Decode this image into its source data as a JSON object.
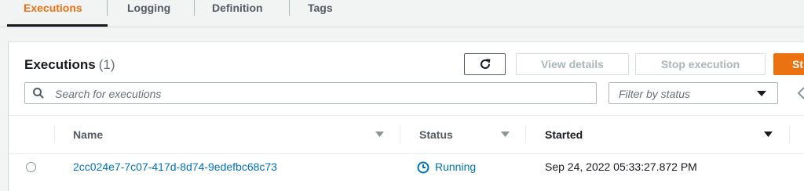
{
  "tabs": [
    {
      "label": "Executions",
      "active": true
    },
    {
      "label": "Logging",
      "active": false
    },
    {
      "label": "Definition",
      "active": false
    },
    {
      "label": "Tags",
      "active": false
    }
  ],
  "panel": {
    "title": "Executions",
    "count": "(1)",
    "buttons": {
      "refresh_icon": "refresh-icon",
      "view_details": "View details",
      "stop_execution": "Stop execution",
      "start_execution": "St"
    },
    "search": {
      "placeholder": "Search for executions"
    },
    "filter": {
      "value": "Filter by status",
      "options_visible": [
        "Filter by status"
      ]
    }
  },
  "table": {
    "columns": [
      "Name",
      "Status",
      "Started"
    ],
    "rows": [
      {
        "name": "2cc024e7-7c07-417d-8d74-9edefbc68c73",
        "status": "Running",
        "started": "Sep 24, 2022 05:33:27.872 PM"
      }
    ]
  },
  "colors": {
    "accent": "#ec7211",
    "link": "#0073bb",
    "text": "#16191f",
    "muted": "#545b64"
  }
}
